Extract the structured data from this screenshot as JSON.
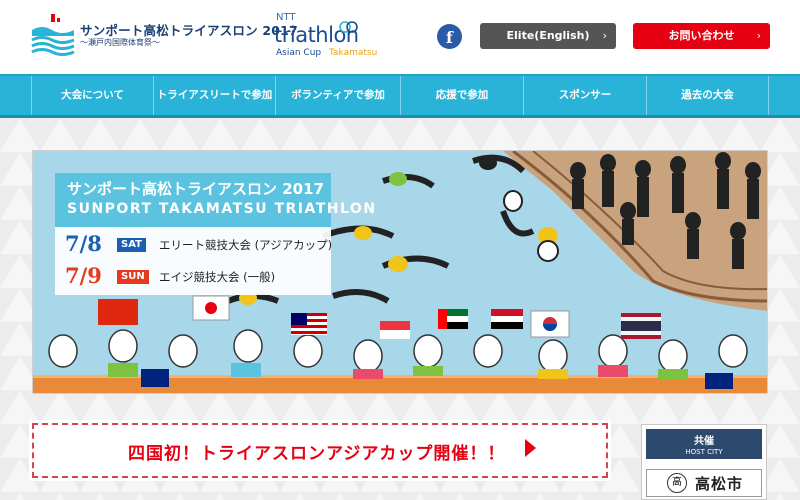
{
  "header": {
    "logo_title": "サンポート高松トライアスロン 2017",
    "logo_subtitle": "〜瀬戸内国際体育祭〜",
    "ntt_top": "NTT",
    "ntt_main": "triathlon",
    "ntt_sub_left": "Asian Cup",
    "ntt_sub_right": "Takamatsu",
    "facebook_glyph": "f",
    "elite_button": "Elite(English)",
    "contact_button": "お問い合わせ",
    "chevron": "›"
  },
  "nav": {
    "items": [
      {
        "label": "大会について"
      },
      {
        "label": "トライアスリートで参加"
      },
      {
        "label": "ボランティアで参加"
      },
      {
        "label": "応援で参加"
      },
      {
        "label": "スポンサー"
      },
      {
        "label": "過去の大会"
      }
    ]
  },
  "hero": {
    "title_jp": "サンポート高松トライアスロン 2017",
    "title_en": "SUNPORT TAKAMATSU TRIATHLON",
    "events": [
      {
        "date": "7/8",
        "day": "SAT",
        "text": "エリート競技大会 (アジアカップ)"
      },
      {
        "date": "7/9",
        "day": "SUN",
        "text": "エイジ競技大会 (一般)"
      }
    ]
  },
  "banner": {
    "text": "四国初！トライアスロンアジアカップ開催！！"
  },
  "host": {
    "label_jp": "共催",
    "label_en": "HOST CITY",
    "seal": "高",
    "city": "高松市"
  },
  "colors": {
    "nav": "#2ab3d8",
    "contact": "#e60012",
    "elite": "#555555",
    "facebook": "#2b5aa7",
    "date_blue": "#1b5fb0",
    "date_red": "#e53a1f",
    "hero_title_bg": "#5bc3df"
  },
  "icons": [
    "facebook-icon",
    "chevron-right-icon",
    "play-arrow-icon"
  ]
}
